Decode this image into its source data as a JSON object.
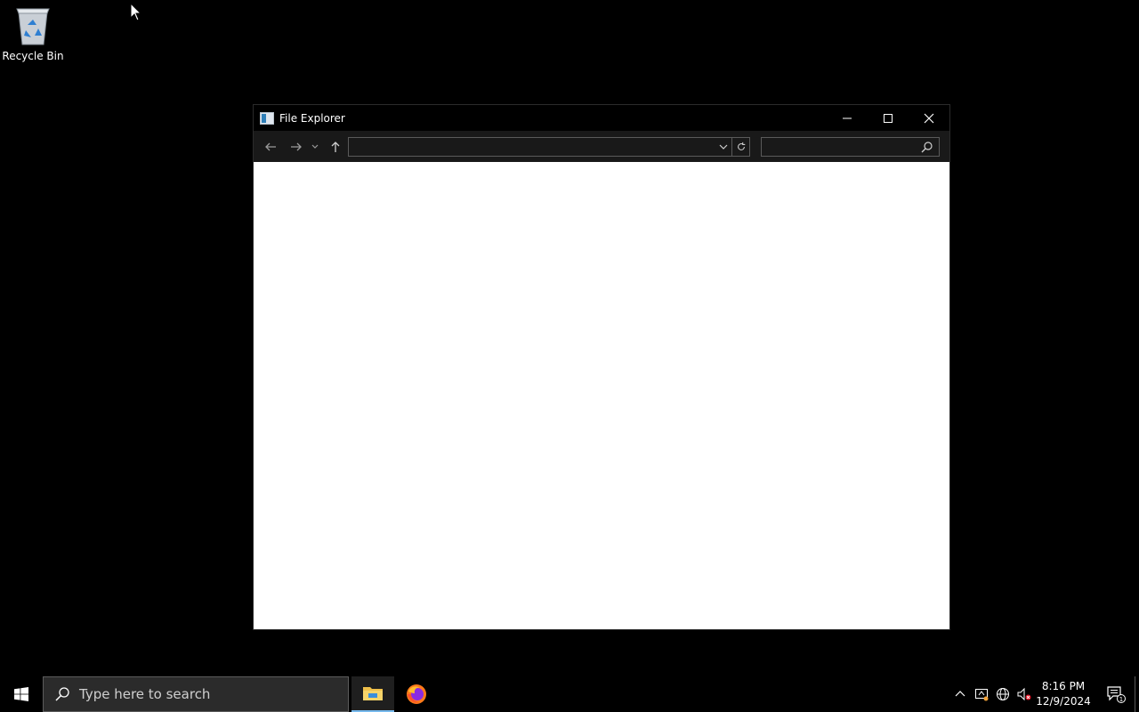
{
  "desktop": {
    "icons": [
      {
        "label": "Recycle Bin",
        "icon": "recycle-bin-icon"
      }
    ]
  },
  "window": {
    "title": "File Explorer",
    "address_value": "",
    "search_placeholder": ""
  },
  "taskbar": {
    "search_placeholder": "Type here to search",
    "apps": [
      "file-explorer-icon",
      "firefox-icon"
    ],
    "clock": {
      "time": "8:16 PM",
      "date": "12/9/2024"
    },
    "notification_count": "1"
  },
  "colors": {
    "taskbar": "#000000",
    "titlebar": "#000000",
    "navbar": "#191919",
    "accent": "#76b9ed"
  }
}
